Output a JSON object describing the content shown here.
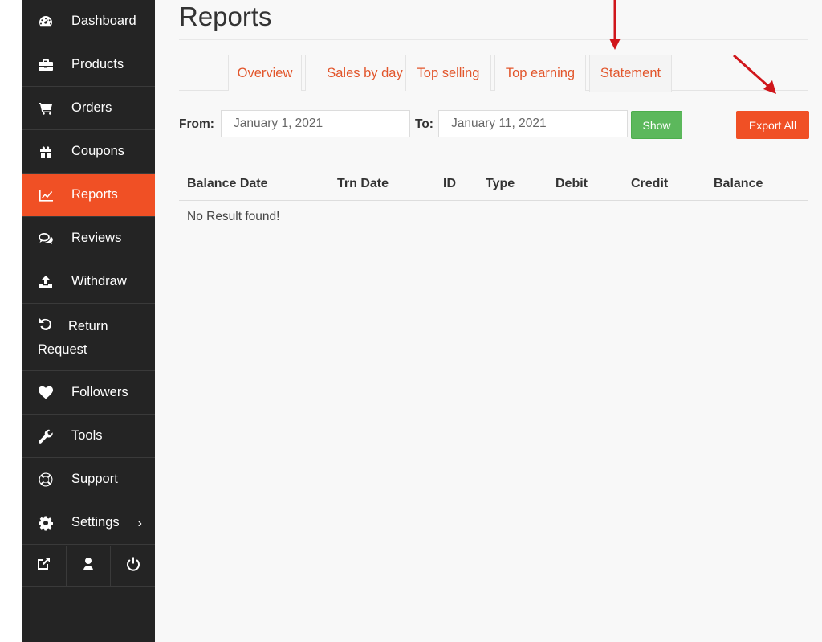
{
  "sidebar": {
    "items": [
      {
        "label": "Dashboard",
        "icon": "dashboard-icon"
      },
      {
        "label": "Products",
        "icon": "briefcase-icon"
      },
      {
        "label": "Orders",
        "icon": "shopping-cart-icon"
      },
      {
        "label": "Coupons",
        "icon": "gift-icon"
      },
      {
        "label": "Reports",
        "icon": "line-chart-icon",
        "active": true
      },
      {
        "label": "Reviews",
        "icon": "comments-icon"
      },
      {
        "label": "Withdraw",
        "icon": "upload-icon"
      },
      {
        "label": "Return",
        "label2": "Request",
        "icon": "undo-icon"
      },
      {
        "label": "Followers",
        "icon": "heart-icon"
      },
      {
        "label": "Tools",
        "icon": "wrench-icon"
      },
      {
        "label": "Support",
        "icon": "life-ring-icon"
      },
      {
        "label": "Settings",
        "icon": "gear-icon",
        "has_submenu": true
      }
    ],
    "bottom_icons": [
      "external-link-icon",
      "user-icon",
      "power-icon"
    ]
  },
  "main": {
    "title": "Reports",
    "tabs": [
      {
        "label": "Overview"
      },
      {
        "label": "Sales by day"
      },
      {
        "label": "Top selling"
      },
      {
        "label": "Top earning"
      },
      {
        "label": "Statement",
        "active": true
      }
    ],
    "filter": {
      "from_label": "From:",
      "from_value": "January 1, 2021",
      "to_label": "To:",
      "to_value": "January 11, 2021",
      "show_label": "Show",
      "export_label": "Export All"
    },
    "table": {
      "columns": [
        "Balance Date",
        "Trn Date",
        "ID",
        "Type",
        "Debit",
        "Credit",
        "Balance"
      ],
      "empty_message": "No Result found!"
    }
  },
  "colors": {
    "sidebar_bg": "#242424",
    "accent": "#f05025",
    "tab_text": "#e2562c",
    "show_button": "#5cb85c",
    "annotation_arrow": "#d0161b"
  }
}
